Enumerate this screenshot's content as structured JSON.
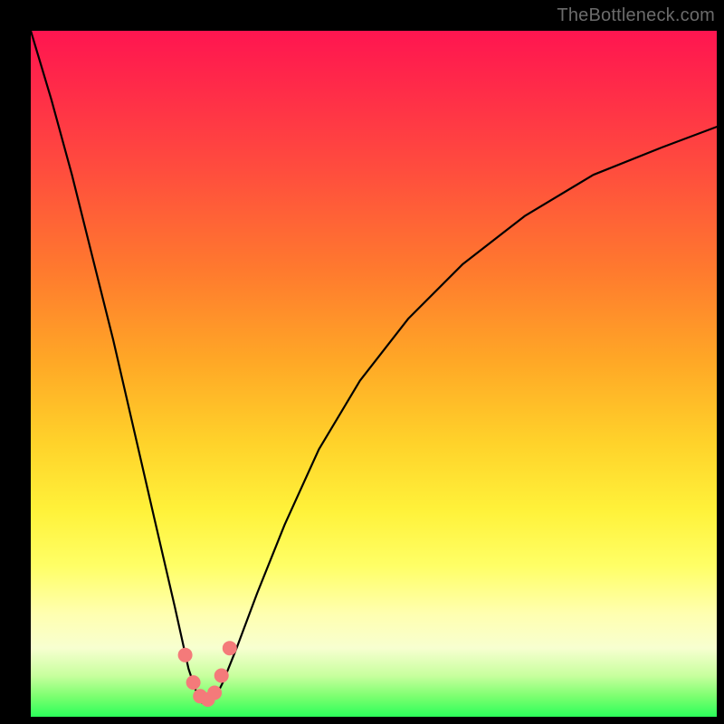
{
  "watermark": "TheBottleneck.com",
  "colors": {
    "background_frame": "#000000",
    "curve": "#000000",
    "dot_fill": "#f47a7a",
    "dot_stroke": "#e65b5b",
    "watermark_text": "#6b6b6b",
    "gradient_stops": [
      "#ff1550",
      "#ff4c3e",
      "#ffa726",
      "#fff23a",
      "#ffffb0",
      "#2bff5a"
    ]
  },
  "chart_data": {
    "type": "line",
    "title": "",
    "xlabel": "",
    "ylabel": "",
    "xlim": [
      0,
      100
    ],
    "ylim": [
      0,
      100
    ],
    "grid": false,
    "legend": false,
    "series": [
      {
        "name": "curve",
        "x": [
          0,
          3,
          6,
          9,
          12,
          15,
          18,
          21,
          23,
          24,
          25,
          26,
          27,
          28,
          30,
          33,
          37,
          42,
          48,
          55,
          63,
          72,
          82,
          92,
          100
        ],
        "y": [
          100,
          90,
          79,
          67,
          55,
          42,
          29,
          16,
          7,
          4,
          2,
          2,
          3,
          5,
          10,
          18,
          28,
          39,
          49,
          58,
          66,
          73,
          79,
          83,
          86
        ]
      }
    ],
    "markers": [
      {
        "x": 22.5,
        "y": 9
      },
      {
        "x": 23.7,
        "y": 5
      },
      {
        "x": 24.7,
        "y": 3
      },
      {
        "x": 25.8,
        "y": 2.5
      },
      {
        "x": 26.8,
        "y": 3.5
      },
      {
        "x": 27.8,
        "y": 6
      },
      {
        "x": 29.0,
        "y": 10
      }
    ],
    "notes": "Axes unlabeled in source image. x/y expressed as percentage of plot-area width/height. y is measured from the bottom (green) edge upward. Curve is a V-shaped bottleneck profile with minimum near x≈26."
  }
}
